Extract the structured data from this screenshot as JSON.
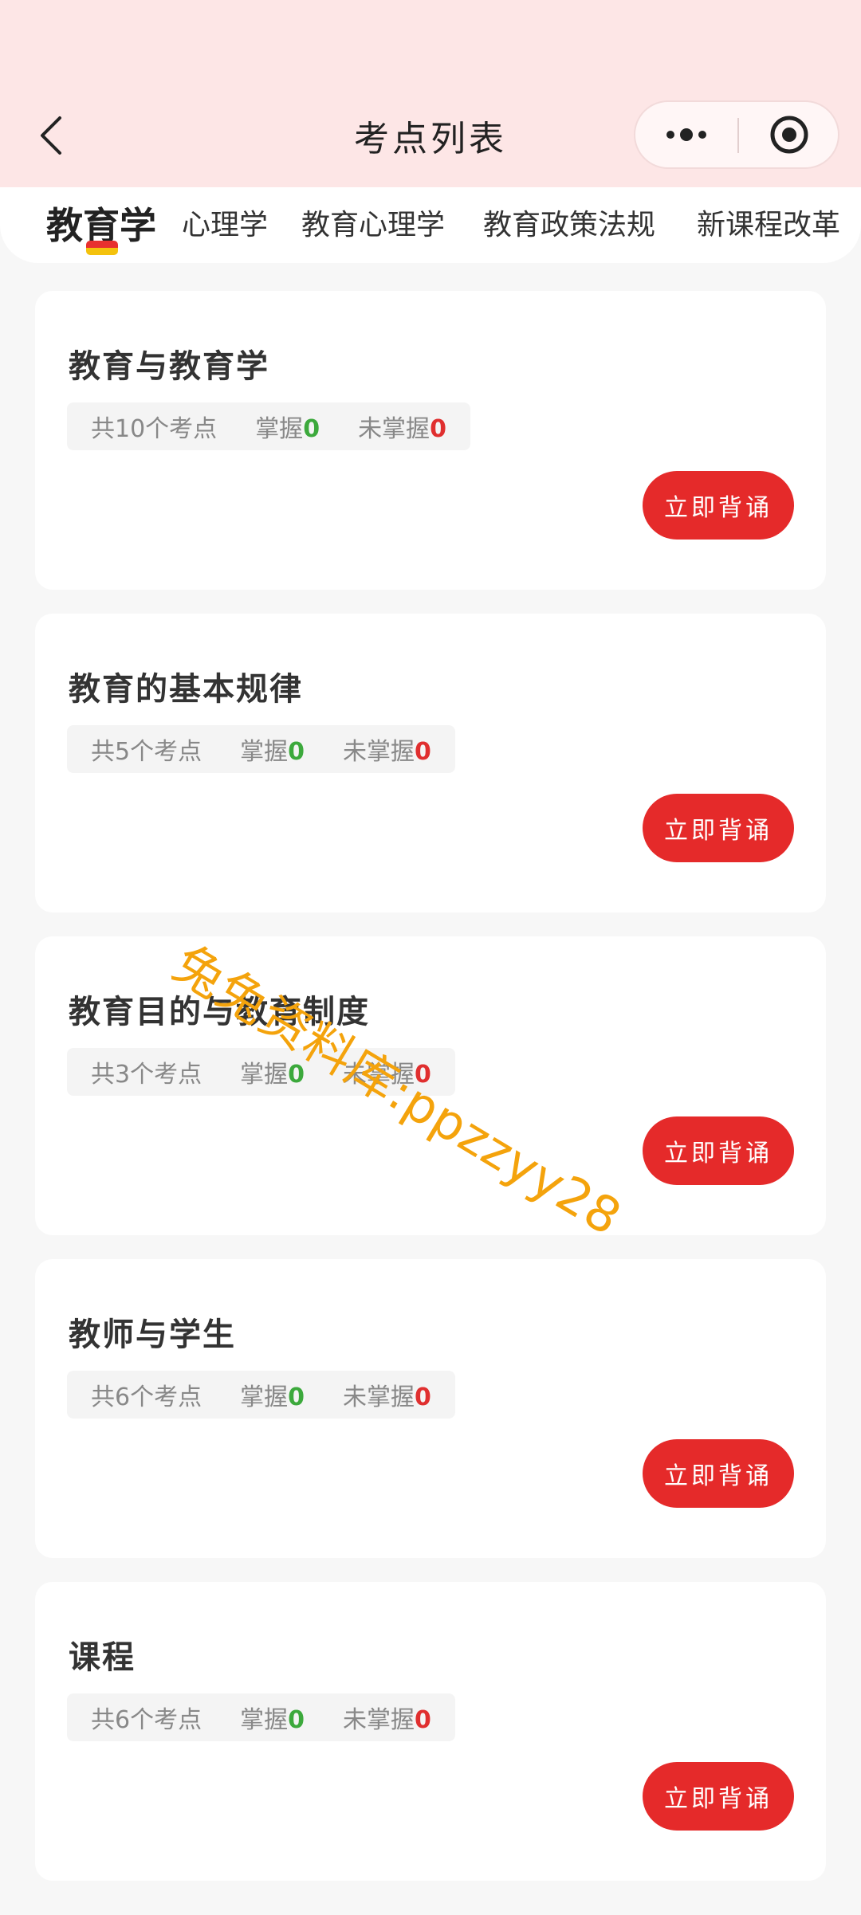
{
  "header": {
    "title": "考点列表",
    "back_icon": "chevron-left-icon",
    "more_icon": "more-dots-icon",
    "close_icon": "target-circle-icon"
  },
  "tabs": [
    {
      "label": "教育学",
      "active": true
    },
    {
      "label": "心理学",
      "active": false
    },
    {
      "label": "教育心理学",
      "active": false
    },
    {
      "label": "教育政策法规",
      "active": false
    },
    {
      "label": "新课程改革",
      "active": false
    }
  ],
  "cards": [
    {
      "title": "教育与教育学",
      "total": "共10个考点",
      "mastered_label": "掌握",
      "mastered": "0",
      "unmastered_label": "未掌握",
      "unmastered": "0",
      "button": "立即背诵"
    },
    {
      "title": "教育的基本规律",
      "total": "共5个考点",
      "mastered_label": "掌握",
      "mastered": "0",
      "unmastered_label": "未掌握",
      "unmastered": "0",
      "button": "立即背诵"
    },
    {
      "title": "教育目的与教育制度",
      "total": "共3个考点",
      "mastered_label": "掌握",
      "mastered": "0",
      "unmastered_label": "未掌握",
      "unmastered": "0",
      "button": "立即背诵"
    },
    {
      "title": "教师与学生",
      "total": "共6个考点",
      "mastered_label": "掌握",
      "mastered": "0",
      "unmastered_label": "未掌握",
      "unmastered": "0",
      "button": "立即背诵"
    },
    {
      "title": "课程",
      "total": "共6个考点",
      "mastered_label": "掌握",
      "mastered": "0",
      "unmastered_label": "未掌握",
      "unmastered": "0",
      "button": "立即背诵"
    }
  ],
  "watermark": "兔兔资料库:ppzzyy28",
  "colors": {
    "accent_red": "#e52a2a",
    "header_bg": "#fde6e6",
    "green": "#3ca93c",
    "tab_indicator_yellow": "#f4c20d"
  }
}
